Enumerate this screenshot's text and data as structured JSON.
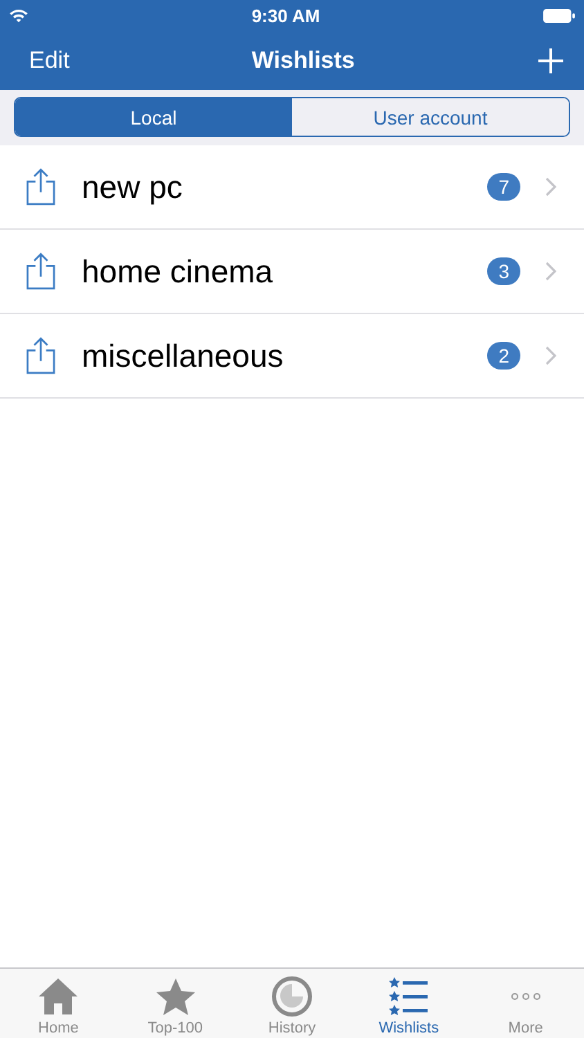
{
  "status_bar": {
    "time": "9:30 AM"
  },
  "nav": {
    "left": "Edit",
    "title": "Wishlists"
  },
  "segments": [
    {
      "label": "Local",
      "selected": true
    },
    {
      "label": "User account",
      "selected": false
    }
  ],
  "wishlists": [
    {
      "name": "new pc",
      "count": "7"
    },
    {
      "name": "home cinema",
      "count": "3"
    },
    {
      "name": "miscellaneous",
      "count": "2"
    }
  ],
  "tab_bar": [
    {
      "kind": "home",
      "label": "Home",
      "selected": false
    },
    {
      "kind": "star",
      "label": "Top-100",
      "selected": false
    },
    {
      "kind": "clock",
      "label": "History",
      "selected": false
    },
    {
      "kind": "list",
      "label": "Wishlists",
      "selected": true
    },
    {
      "kind": "more",
      "label": "More",
      "selected": false
    }
  ]
}
